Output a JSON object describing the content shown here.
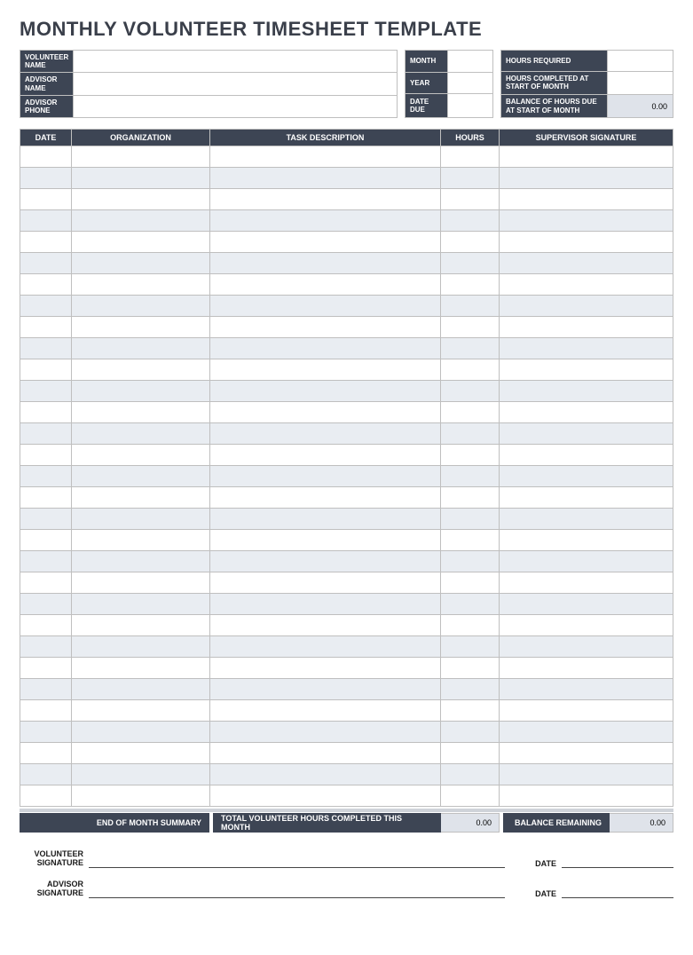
{
  "title": "MONTHLY VOLUNTEER TIMESHEET TEMPLATE",
  "header_left": {
    "vol_name_label": "VOLUNTEER NAME",
    "vol_name_value": "",
    "adv_name_label": "ADVISOR NAME",
    "adv_name_value": "",
    "adv_phone_label": "ADVISOR PHONE",
    "adv_phone_value": ""
  },
  "header_mid": {
    "month_label": "MONTH",
    "month_value": "",
    "year_label": "YEAR",
    "year_value": "",
    "due_label": "DATE DUE",
    "due_value": ""
  },
  "header_right": {
    "req_label": "HOURS REQUIRED",
    "req_value": "",
    "comp_label": "HOURS COMPLETED AT START OF MONTH",
    "comp_value": "",
    "bal_label": "BALANCE OF HOURS DUE AT START OF MONTH",
    "bal_value": "0.00"
  },
  "columns": {
    "date": "DATE",
    "org": "ORGANIZATION",
    "task": "TASK DESCRIPTION",
    "hours": "HOURS",
    "sig": "SUPERVISOR SIGNATURE"
  },
  "row_count": 31,
  "summary": {
    "eom": "END OF MONTH SUMMARY",
    "total_label": "TOTAL VOLUNTEER HOURS COMPLETED THIS MONTH",
    "total_value": "0.00",
    "balrem_label": "BALANCE REMAINING",
    "balrem_value": "0.00"
  },
  "signatures": {
    "vol": "VOLUNTEER SIGNATURE",
    "adv": "ADVISOR SIGNATURE",
    "date": "DATE"
  }
}
